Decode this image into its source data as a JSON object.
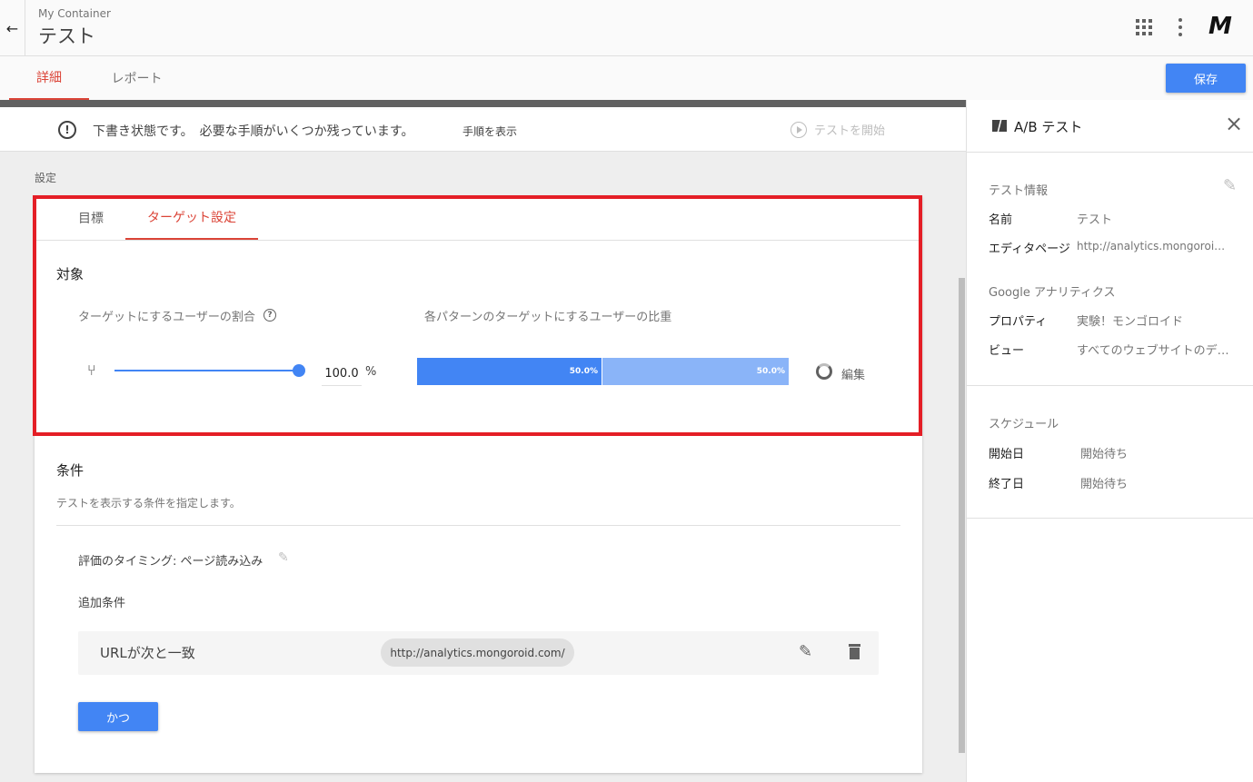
{
  "header": {
    "back_icon": "arrow-left-icon",
    "container_name": "My Container",
    "title": "テスト",
    "logo": "M"
  },
  "tabs": [
    {
      "label": "詳細",
      "active": true
    },
    {
      "label": "レポート",
      "active": false
    }
  ],
  "save_label": "保存",
  "banner": {
    "text": "下書き状態です。　必要な手順がいくつか残っています。",
    "link": "手順を表示",
    "start_label": "テストを開始"
  },
  "section_label": "設定",
  "card": {
    "tabs": [
      {
        "label": "目標",
        "active": false
      },
      {
        "label": "ターゲット設定",
        "active": true
      }
    ],
    "targeting": {
      "heading": "対象",
      "ratio_label": "ターゲットにするユーザーの割合",
      "ratio_value": "100.0",
      "ratio_unit": "%",
      "weight_label": "各パターンのターゲットにするユーザーの比重",
      "weights": [
        "50.0%",
        "50.0%"
      ],
      "edit_label": "編集"
    },
    "conditions": {
      "heading": "条件",
      "description": "テストを表示する条件を指定します。",
      "timing": "評価のタイミング: ページ読み込み",
      "extra_label": "追加条件",
      "rule_label": "URLが次と一致",
      "rule_value": "http://analytics.mongoroid.com/",
      "and_label": "かつ"
    }
  },
  "panel": {
    "title": "A/B テスト",
    "info_heading": "テスト情報",
    "name_key": "名前",
    "name_value": "テスト",
    "editor_key": "エディタページ",
    "editor_value": "http://analytics.mongoroid.com/",
    "ga_heading": "Google アナリティクス",
    "property_key": "プロパティ",
    "property_value": "実験！モンゴロイド",
    "view_key": "ビュー",
    "view_value": "すべてのウェブサイトのデータ",
    "schedule_heading": "スケジュール",
    "start_key": "開始日",
    "start_value": "開始待ち",
    "end_key": "終了日",
    "end_value": "開始待ち"
  },
  "colors": {
    "accent": "#4285f4",
    "tab_active": "#db4437",
    "highlight_frame": "#e41e26"
  }
}
